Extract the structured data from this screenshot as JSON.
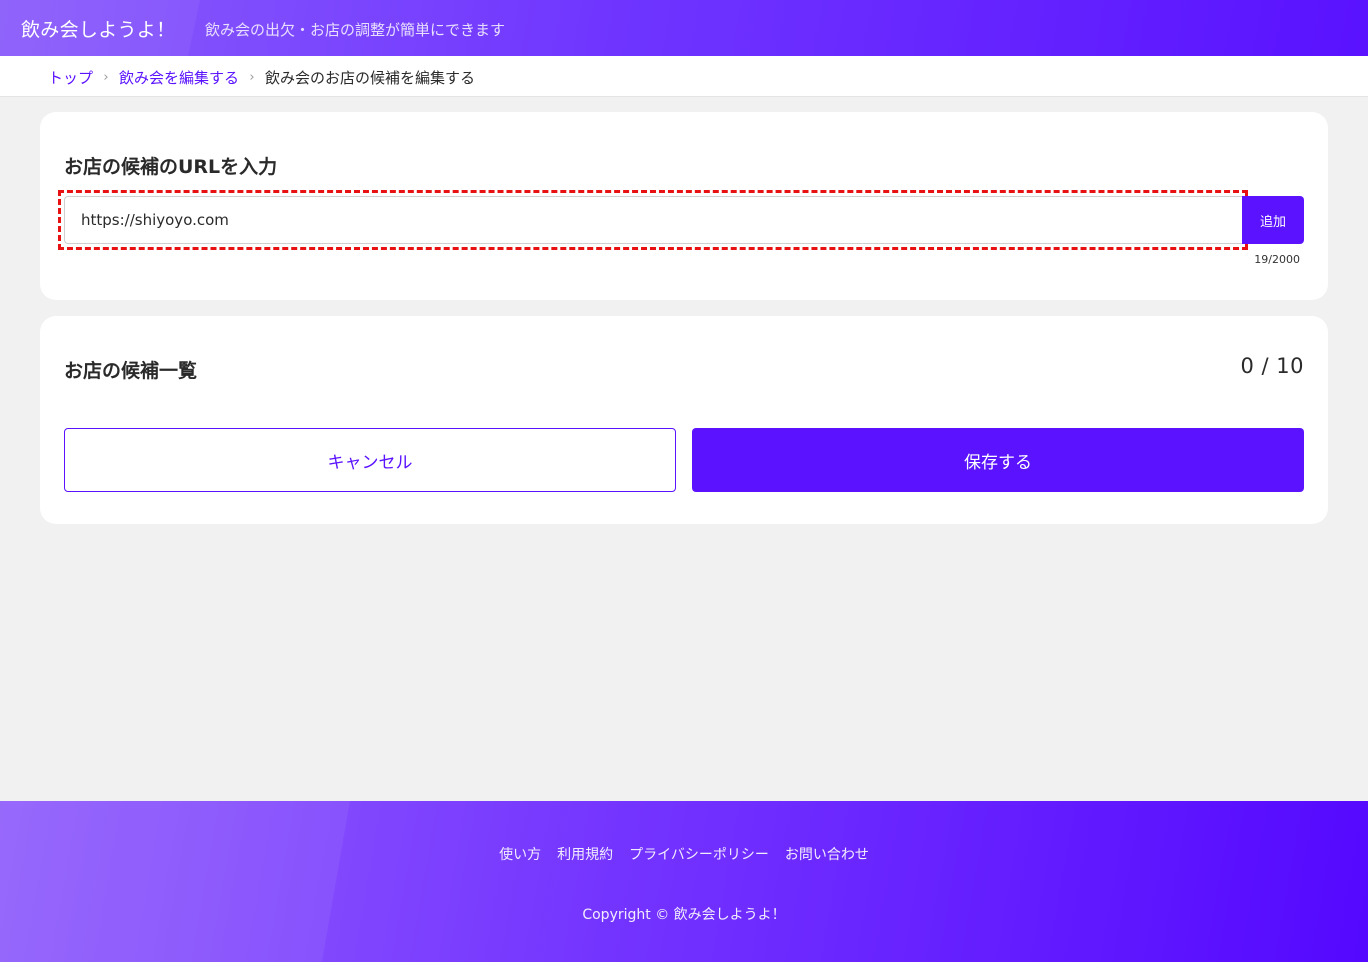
{
  "header": {
    "brand": "飲み会しようよ！",
    "tagline": "飲み会の出欠・お店の調整が簡単にできます"
  },
  "breadcrumb": {
    "items": [
      {
        "label": "トップ"
      },
      {
        "label": "飲み会を編集する"
      },
      {
        "label": "飲み会のお店の候補を編集する"
      }
    ],
    "separator": "›"
  },
  "url_section": {
    "title": "お店の候補のURLを入力",
    "input_value": "https://shiyoyo.com",
    "add_label": "追加",
    "char_count": "19/2000"
  },
  "list_section": {
    "title": "お店の候補一覧",
    "count": "0 / 10",
    "cancel_label": "キャンセル",
    "save_label": "保存する"
  },
  "footer": {
    "links": [
      {
        "label": "使い方"
      },
      {
        "label": "利用規約"
      },
      {
        "label": "プライバシーポリシー"
      },
      {
        "label": "お問い合わせ"
      }
    ],
    "copyright": "Copyright © 飲み会しようよ！"
  },
  "colors": {
    "accent": "#5a12ff",
    "focus_outline": "#e81010",
    "page_bg": "#f1f1f1"
  }
}
